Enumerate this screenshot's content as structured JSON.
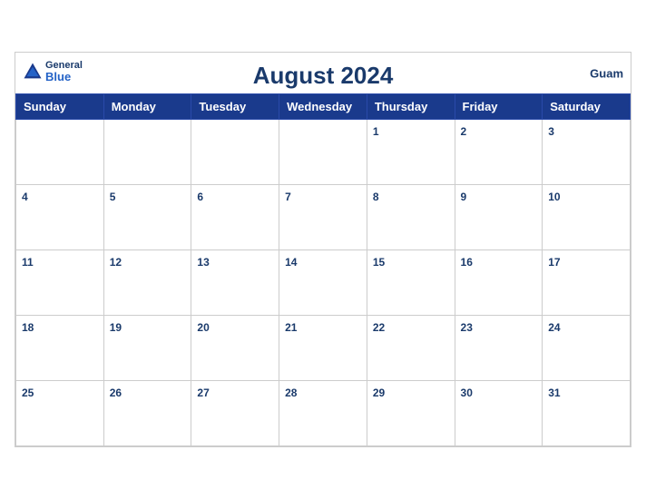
{
  "header": {
    "brand_general": "General",
    "brand_blue": "Blue",
    "title": "August 2024",
    "region": "Guam"
  },
  "weekdays": [
    "Sunday",
    "Monday",
    "Tuesday",
    "Wednesday",
    "Thursday",
    "Friday",
    "Saturday"
  ],
  "weeks": [
    [
      null,
      null,
      null,
      null,
      1,
      2,
      3
    ],
    [
      4,
      5,
      6,
      7,
      8,
      9,
      10
    ],
    [
      11,
      12,
      13,
      14,
      15,
      16,
      17
    ],
    [
      18,
      19,
      20,
      21,
      22,
      23,
      24
    ],
    [
      25,
      26,
      27,
      28,
      29,
      30,
      31
    ]
  ]
}
